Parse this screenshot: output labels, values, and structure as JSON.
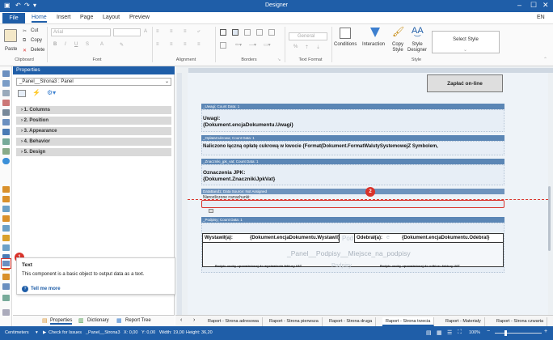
{
  "window": {
    "title": "Designer",
    "language": "EN",
    "controls": [
      "–",
      "☐",
      "✕"
    ]
  },
  "menu": {
    "file": "File",
    "tabs": [
      "Home",
      "Insert",
      "Page",
      "Layout",
      "Preview"
    ]
  },
  "ribbon": {
    "clipboard": {
      "paste": "Paste",
      "cut": "Cut",
      "copy": "Copy",
      "delete": "Delete",
      "label": "Clipboard"
    },
    "font": {
      "family": "Arial",
      "label": "Font"
    },
    "alignment": {
      "label": "Alignment"
    },
    "borders": {
      "label": "Borders"
    },
    "text_format": {
      "format": "General",
      "label": "Text Format"
    },
    "style": {
      "conditions": "Conditions",
      "interaction": "Interaction",
      "copy_style": "Copy Style",
      "style_designer": "Style Designer",
      "select_style": "Select Style",
      "label": "Style"
    }
  },
  "properties": {
    "title": "Properties",
    "selected": "_Panel__Strona3 : Panel",
    "categories": [
      "1. Columns",
      "2. Position",
      "3. Appearance",
      "4. Behavior",
      "5. Design"
    ]
  },
  "tooltip": {
    "badge": "1",
    "title": "Text",
    "description": "This component is a basic object to output data as a text.",
    "link": "Tell me more"
  },
  "panel_tabs": [
    "Properties",
    "Dictionary",
    "Report Tree"
  ],
  "report": {
    "paid_online": "Zapłać on-line",
    "bands": [
      {
        "header": "_Uwagi; Count Data: 1",
        "lines": [
          "Uwagi:",
          "{Dokument.encjaDokumentu.Uwagi}"
        ]
      },
      {
        "header": "_OplataCukrowa; Count Data: 1",
        "lines": [
          "Naliczono łączną opłatę cukrową w kwocie {Format(Dokument.FormatWalutySystemowejZ Symbolem,"
        ]
      },
      {
        "header": "_Znaczniki_jpk_vat; Count Data: 1",
        "lines": [
          "Oznaczenia JPK:",
          "{Dokument.ZnacznikiJpkVat}"
        ]
      },
      {
        "header": "DataBand1; Data Source: Not Assigned",
        "lines": [
          "Nierozliczone rozrachunki:"
        ]
      },
      {
        "header": "_Podpisy; Count Data: 1",
        "lines": []
      }
    ],
    "badge2": "2",
    "sign": {
      "issued_label": "Wystawił(a):",
      "issued_value": "{Dokument.encjaDokumentu.Wystawil}",
      "received_label": "Odebrał(a):",
      "received_value": "{Dokument.encjaDokumentu.Odebral}",
      "watermark": "_Panel__Podpisy__Miejsce_na_podpisy",
      "left_caption": "Podpis osoby upoważnionej do wystawienia faktury VAT",
      "right_caption": "Podpis osoby upoważnionej do odbioru faktury VAT",
      "ghost_1": "Pod",
      "ghost_2": "Podpisy",
      "ghost_3": "e"
    }
  },
  "report_tabs": [
    "Raport - Strona adresowa",
    "Raport - Strona pierwsza",
    "Raport - Strona druga",
    "Raport - Strona trzecia",
    "Raport - Materiały",
    "Raport - Strona czwarta"
  ],
  "active_report_tab": "Raport - Strona trzecia",
  "status": {
    "units": "Centimeters",
    "check": "Check for Issues",
    "component": "_Panel__Strona3",
    "x": "X: 0,00",
    "y": "Y: 0,00",
    "width": "Width: 19,00",
    "height": "Height: 36,20",
    "zoom": "100%"
  },
  "colors": {
    "accent": "#1f5ea8",
    "band_header": "#5b86b5",
    "badge": "#d9332b"
  }
}
